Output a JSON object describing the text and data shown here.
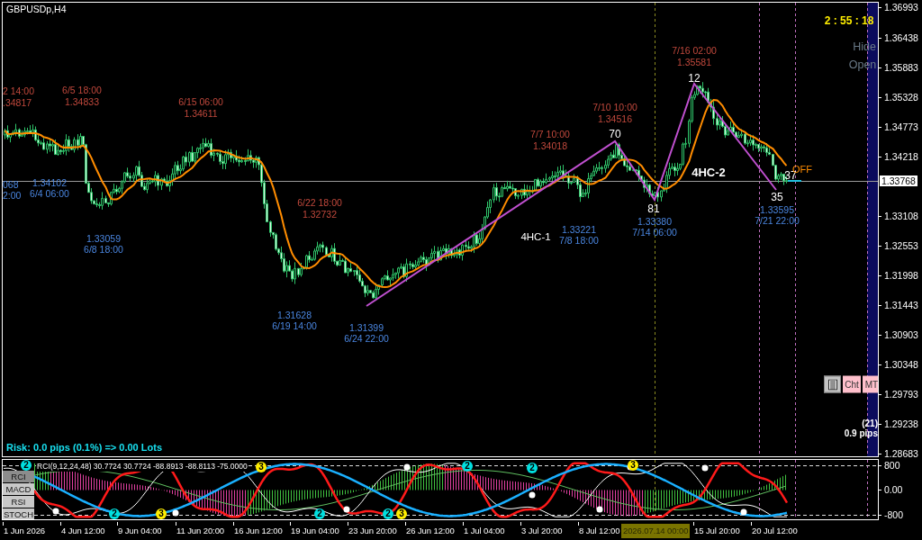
{
  "chart": {
    "title": "GBPUSDp,H4",
    "timer": "2 : 55 : 18",
    "hide_label": "Hide",
    "open_label": "Open",
    "risk_text": "Risk: 0.0 pips (0.1%) => 0.00 Lots",
    "spread_count": "(21)",
    "spread_pips": "0.9 pips",
    "toolbar": [
      {
        "kind": "icon"
      },
      {
        "kind": "text",
        "label": "Cht"
      },
      {
        "kind": "text",
        "label": "MT"
      }
    ],
    "current_price": "1.33768",
    "price_axis": [
      "1.36993",
      "1.36438",
      "1.35883",
      "1.35328",
      "1.34773",
      "1.34218",
      "1.33108",
      "1.32553",
      "1.31998",
      "1.31443",
      "1.30903",
      "1.30348",
      "1.29793",
      "1.29238",
      "1.28683"
    ],
    "high_labels": [
      {
        "time": "2 14:00",
        "price": ".34817"
      },
      {
        "time": "6/5 18:00",
        "price": "1.34833"
      },
      {
        "time": "6/15 06:00",
        "price": "1.34611"
      },
      {
        "time": "6/22 18:00",
        "price": "1.32732"
      },
      {
        "time": "7/7 10:00",
        "price": "1.34018"
      },
      {
        "time": "7/10 10:00",
        "price": "1.34516"
      },
      {
        "time": "7/16 02:00",
        "price": "1.35581"
      }
    ],
    "low_labels": [
      {
        "price": "068",
        "time": "2:00"
      },
      {
        "price": "1.34102",
        "time": "6/4 06:00"
      },
      {
        "price": "1.33059",
        "time": "6/8 18:00"
      },
      {
        "price": "1.31628",
        "time": "6/19 14:00"
      },
      {
        "price": "1.31399",
        "time": "6/24 22:00"
      },
      {
        "price": "1.33221",
        "time": "7/8 18:00"
      },
      {
        "price": "1.33380",
        "time": "7/14 06:00"
      },
      {
        "price": "1.33595",
        "time": "7/21 22:00"
      }
    ],
    "wave_counts": [
      "70",
      "81",
      "12",
      "35",
      "37"
    ],
    "pattern_labels": [
      {
        "label": "4HC-1",
        "bold": false
      },
      {
        "label": "4HC-2",
        "bold": true
      }
    ],
    "status": "OFF"
  },
  "indicator": {
    "legend": "RCI(9,12,24,48) 30.7724 30.7724 -88.8913 -88.8113 -75.0000",
    "buttons": [
      {
        "label": "RCI",
        "selected": true
      },
      {
        "label": "MACD",
        "selected": false
      },
      {
        "label": "RSI",
        "selected": false
      },
      {
        "label": "STOCH",
        "selected": false
      }
    ],
    "axis": [
      "800",
      "0.00",
      "-800"
    ],
    "markers": [
      {
        "label": "2",
        "color": "#00e0e0"
      },
      {
        "label": "2",
        "color": "#00e0e0"
      },
      {
        "label": "3",
        "color": "#ffee00"
      },
      {
        "label": "3",
        "color": "#ffee00"
      },
      {
        "label": "2",
        "color": "#00e0e0"
      },
      {
        "label": "2",
        "color": "#00e0e0"
      },
      {
        "label": "3",
        "color": "#ffee00"
      },
      {
        "label": "2",
        "color": "#00e0e0"
      },
      {
        "label": "2",
        "color": "#00e0e0"
      },
      {
        "label": "3",
        "color": "#ffee00"
      }
    ]
  },
  "time_axis": {
    "labels": [
      "1 Jun 2026",
      "4 Jun 12:00",
      "9 Jun 04:00",
      "11 Jun 20:00",
      "16 Jun 12:00",
      "19 Jun 04:00",
      "23 Jun 20:00",
      "26 Jun 12:00",
      "1 Jul 04:00",
      "3 Jul 20:00",
      "8 Jul 12:00",
      "15 Jul 20:00",
      "20 Jul 12:00"
    ],
    "cursor_time": "2026.07.14 00:00"
  }
}
